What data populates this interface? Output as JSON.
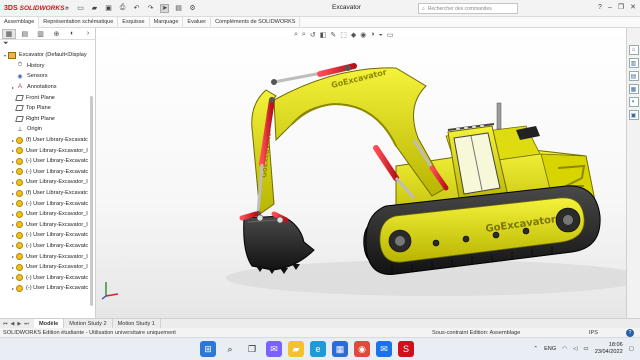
{
  "app": {
    "brand_ds": "3DS",
    "brand_name": "SOLIDWORKS",
    "document_title": "Excavator",
    "search_placeholder": "Rechercher des commandes"
  },
  "command_tabs": [
    "Assemblage",
    "Représentation schématique",
    "Esquisse",
    "Marquage",
    "Evaluer",
    "Compléments de SOLIDWORKS"
  ],
  "feature_tree": {
    "root": "Excavator  (Default<Display",
    "items": [
      {
        "label": "History",
        "icon": "history-icon",
        "kind": "hist"
      },
      {
        "label": "Sensors",
        "icon": "sensors-icon",
        "kind": "sens"
      },
      {
        "label": "Annotations",
        "icon": "annotations-icon",
        "kind": "ann"
      },
      {
        "label": "Front Plane",
        "icon": "plane-icon",
        "kind": "plane"
      },
      {
        "label": "Top Plane",
        "icon": "plane-icon",
        "kind": "plane"
      },
      {
        "label": "Right Plane",
        "icon": "plane-icon",
        "kind": "plane"
      },
      {
        "label": "Origin",
        "icon": "origin-icon",
        "kind": "orig"
      },
      {
        "label": "(f) User Library-Excavatc",
        "icon": "part-icon",
        "kind": "part"
      },
      {
        "label": "User Library-Excavator_I",
        "icon": "part-icon",
        "kind": "part"
      },
      {
        "label": "(-) User Library-Excavatc",
        "icon": "part-icon",
        "kind": "part"
      },
      {
        "label": "(-) User Library-Excavatc",
        "icon": "part-icon",
        "kind": "part"
      },
      {
        "label": "User Library-Excavator_I",
        "icon": "part-icon",
        "kind": "part"
      },
      {
        "label": "(f) User Library-Excavatc",
        "icon": "part-icon",
        "kind": "part"
      },
      {
        "label": "(-) User Library-Excavatc",
        "icon": "part-icon",
        "kind": "part"
      },
      {
        "label": "User Library-Excavator_I",
        "icon": "part-icon",
        "kind": "part"
      },
      {
        "label": "User Library-Excavator_I",
        "icon": "part-icon",
        "kind": "part"
      },
      {
        "label": "(-) User Library-Excavatc",
        "icon": "part-icon",
        "kind": "part"
      },
      {
        "label": "(-) User Library-Excavatc",
        "icon": "part-icon",
        "kind": "part"
      },
      {
        "label": "User Library-Excavator_I",
        "icon": "part-icon",
        "kind": "part"
      },
      {
        "label": "User Library-Excavator_I",
        "icon": "part-icon",
        "kind": "part"
      },
      {
        "label": "(-) User Library-Excavatc",
        "icon": "part-icon",
        "kind": "part"
      },
      {
        "label": "(-) User Library-Excavatc",
        "icon": "part-icon",
        "kind": "part"
      }
    ]
  },
  "model": {
    "decal_boom": "GoExcavator",
    "decal_body": "GoExcavator",
    "colors": {
      "body": "#e7e41c",
      "body_shadow": "#a9a400",
      "cylinder": "#e0202a",
      "track": "#2a2a2a",
      "bucket": "#1e1e1e"
    }
  },
  "model_tabs": [
    "Modèle",
    "Motion Study 2",
    "Motion Study 1"
  ],
  "statusbar": {
    "left": "SOLIDWORKS Edition étudiante - Utilisation universitaire uniquement",
    "mid": "Sous-contraint  Edition: Assemblage",
    "units": "IPS"
  },
  "taskbar": {
    "lang": "ENG",
    "time": "18:06",
    "date": "23/04/2022"
  }
}
